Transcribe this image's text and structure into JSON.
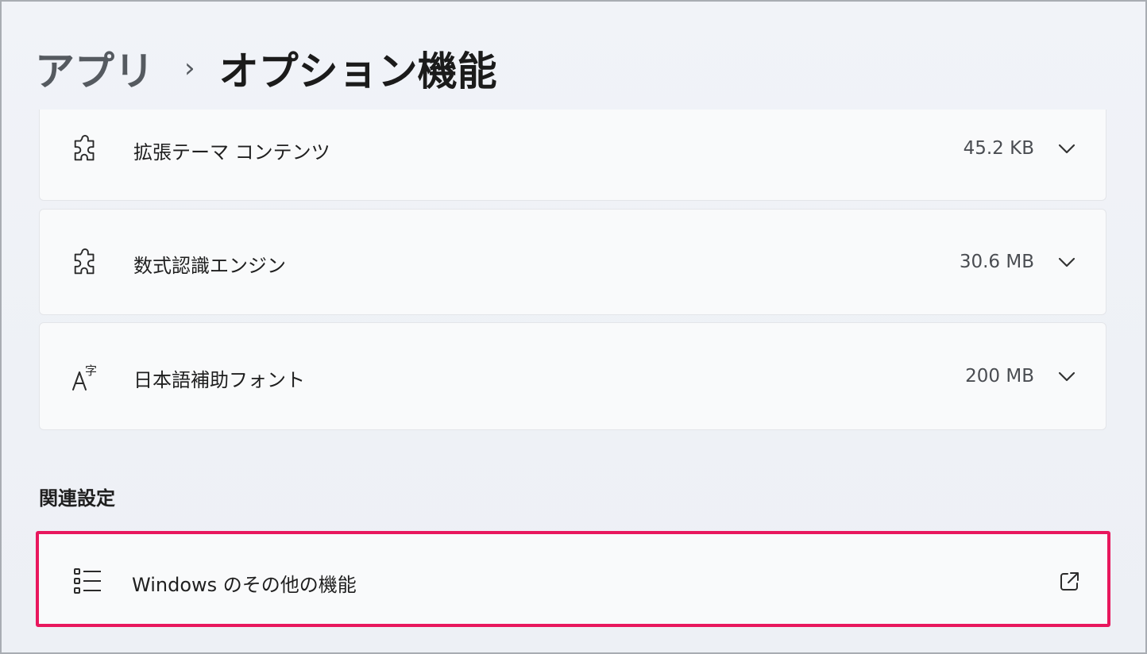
{
  "breadcrumb": {
    "parent": "アプリ",
    "separator": "›",
    "current": "オプション機能"
  },
  "features": [
    {
      "label": "拡張テーマ コンテンツ",
      "size": "45.2 KB",
      "icon": "puzzle-icon"
    },
    {
      "label": "数式認識エンジン",
      "size": "30.6 MB",
      "icon": "puzzle-icon"
    },
    {
      "label": "日本語補助フォント",
      "size": "200 MB",
      "icon": "font-character-icon"
    }
  ],
  "related": {
    "title": "関連設定",
    "items": [
      {
        "label": "Windows のその他の機能",
        "icon": "list-icon",
        "action_icon": "open-external-icon"
      }
    ]
  },
  "colors": {
    "highlight": "#e8175d",
    "background": "#eef1f6",
    "card": "#f9fafb"
  }
}
